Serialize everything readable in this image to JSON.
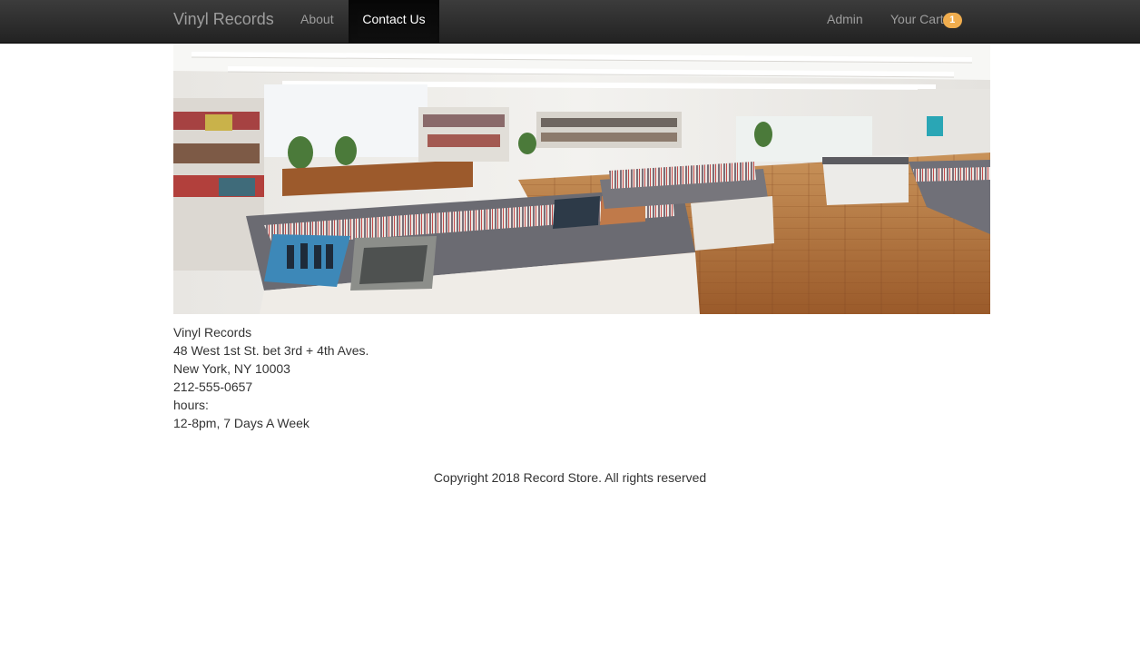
{
  "navbar": {
    "brand": "Vinyl Records",
    "about": "About",
    "contact": "Contact Us",
    "admin": "Admin",
    "cart_label": "Your Cart",
    "cart_count": "1",
    "badge_color": "#f0ad4e"
  },
  "store_info": {
    "name": "Vinyl Records",
    "street": "48 West 1st St. bet 3rd + 4th Aves.",
    "city": "New York, NY 10003",
    "phone": "212-555-0657",
    "hours_label": "hours:",
    "hours": "12-8pm, 7 Days A Week"
  },
  "footer": {
    "copyright": "Copyright 2018 Record Store. All rights reserved"
  }
}
